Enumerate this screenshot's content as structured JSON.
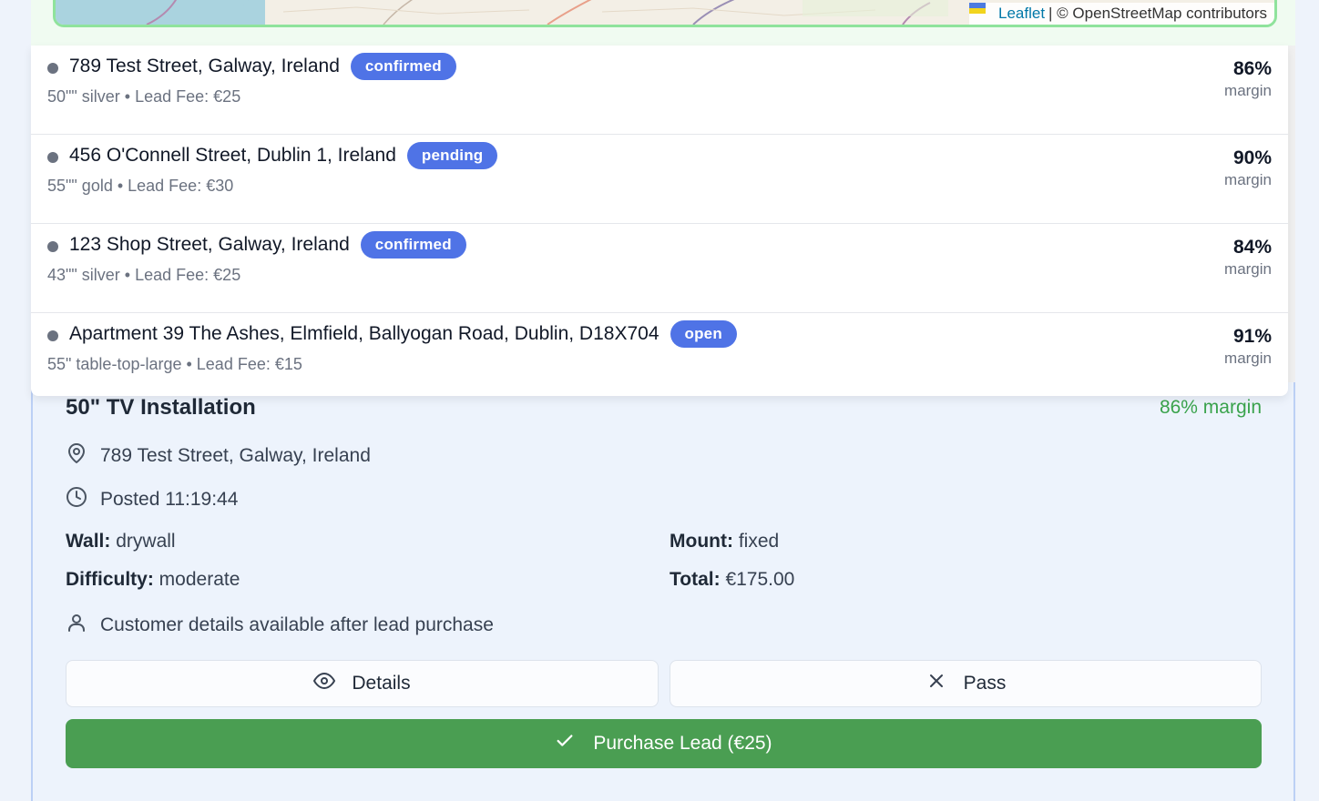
{
  "map": {
    "attribution_link": "Leaflet",
    "attribution_text": "| © OpenStreetMap contributors"
  },
  "leads": [
    {
      "address": "789 Test Street, Galway, Ireland",
      "status": "confirmed",
      "meta": "50\"\" silver • Lead Fee: €25",
      "margin": "86%",
      "margin_label": "margin"
    },
    {
      "address": "456 O'Connell Street, Dublin 1, Ireland",
      "status": "pending",
      "meta": "55\"\" gold • Lead Fee: €30",
      "margin": "90%",
      "margin_label": "margin"
    },
    {
      "address": "123 Shop Street, Galway, Ireland",
      "status": "confirmed",
      "meta": "43\"\" silver • Lead Fee: €25",
      "margin": "84%",
      "margin_label": "margin"
    },
    {
      "address": "Apartment 39 The Ashes, Elmfield, Ballyogan Road, Dublin, D18X704",
      "status": "open",
      "meta": "55\" table-top-large • Lead Fee: €15",
      "margin": "91%",
      "margin_label": "margin"
    }
  ],
  "detail": {
    "title": "50\" TV Installation",
    "margin": "86% margin",
    "address": "789 Test Street, Galway, Ireland",
    "posted": "Posted 11:19:44",
    "wall_label": "Wall:",
    "wall_value": "drywall",
    "mount_label": "Mount:",
    "mount_value": "fixed",
    "difficulty_label": "Difficulty:",
    "difficulty_value": "moderate",
    "total_label": "Total:",
    "total_value": "€175.00",
    "customer_note": "Customer details available after lead purchase",
    "details_button": "Details",
    "pass_button": "Pass",
    "purchase_button": "Purchase Lead (€25)"
  },
  "colors": {
    "badge": "#4f73e6",
    "purchase": "#4a9e52",
    "margin_green": "#3aa34c"
  }
}
